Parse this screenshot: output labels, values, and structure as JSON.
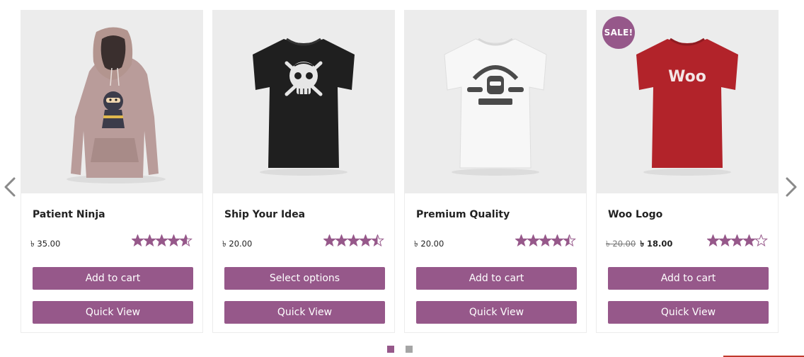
{
  "colors": {
    "accent": "#96588a",
    "card_border": "#ececec",
    "image_bg": "#ececec",
    "star": "#96588a",
    "dot_active": "#96588a",
    "dot_inactive": "#a5a5a5"
  },
  "carousel": {
    "prev_icon": "chevron-left-icon",
    "next_icon": "chevron-right-icon",
    "page_count": 2,
    "active_page": 1
  },
  "products": [
    {
      "title": "Patient Ninja",
      "image": "pink-ninja-hoodie",
      "price": "৳ 35.00",
      "rating": 4.6,
      "button": "Add to cart",
      "quick_view": "Quick View"
    },
    {
      "title": "Ship Your Idea",
      "image": "black-skull-tshirt",
      "price": "৳ 20.00",
      "rating": 4.5,
      "button": "Select options",
      "quick_view": "Quick View"
    },
    {
      "title": "Premium Quality",
      "image": "white-woothemes-tshirt",
      "price": "৳ 20.00",
      "rating": 4.5,
      "button": "Add to cart",
      "quick_view": "Quick View"
    },
    {
      "title": "Woo Logo",
      "image": "red-woo-tshirt",
      "badge": "SALE!",
      "old_price": "৳ 20.00",
      "price": "৳ 18.00",
      "rating": 4.0,
      "button": "Add to cart",
      "quick_view": "Quick View"
    }
  ]
}
